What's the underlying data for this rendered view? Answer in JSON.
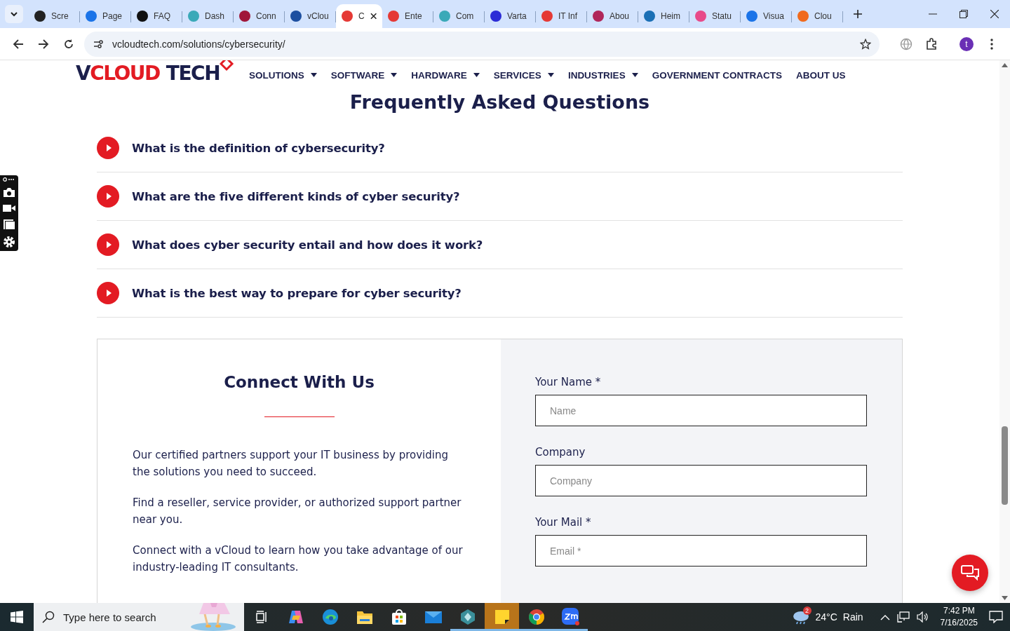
{
  "browser": {
    "tabs": [
      {
        "title": "Scre",
        "color": "#222222",
        "selected": false
      },
      {
        "title": "Page",
        "color": "#1a73e8",
        "selected": false
      },
      {
        "title": "FAQ",
        "color": "#111111",
        "selected": false
      },
      {
        "title": "Dash",
        "color": "#3aa9b8",
        "selected": false
      },
      {
        "title": "Conn",
        "color": "#a0163a",
        "selected": false
      },
      {
        "title": "vClou",
        "color": "#1d4fa0",
        "selected": false
      },
      {
        "title": "C",
        "color": "#e53935",
        "selected": true
      },
      {
        "title": "Ente",
        "color": "#e53935",
        "selected": false
      },
      {
        "title": "Com",
        "color": "#3aa9b8",
        "selected": false
      },
      {
        "title": "Varta",
        "color": "#2b2bd6",
        "selected": false
      },
      {
        "title": "IT Inf",
        "color": "#e53935",
        "selected": false
      },
      {
        "title": "Abou",
        "color": "#b0265a",
        "selected": false
      },
      {
        "title": "Heim",
        "color": "#1a6fb5",
        "selected": false
      },
      {
        "title": "Statu",
        "color": "#e84a8a",
        "selected": false
      },
      {
        "title": "Visua",
        "color": "#1a73e8",
        "selected": false
      },
      {
        "title": "Clou",
        "color": "#f06a1d",
        "selected": false
      }
    ],
    "address": "vcloudtech.com/solutions/cybersecurity/",
    "profile_initial": "t"
  },
  "site_header": {
    "logo": [
      {
        "text": "V",
        "color": "#1b1f4b"
      },
      {
        "text": "CLOUD",
        "color": "#e31b23"
      },
      {
        "text": "TECH",
        "color": "#1b1f4b"
      }
    ],
    "nav": [
      {
        "label": "SOLUTIONS",
        "dropdown": true
      },
      {
        "label": "SOFTWARE",
        "dropdown": true
      },
      {
        "label": "HARDWARE",
        "dropdown": true
      },
      {
        "label": "SERVICES",
        "dropdown": true
      },
      {
        "label": "INDUSTRIES",
        "dropdown": true
      },
      {
        "label": "GOVERNMENT CONTRACTS",
        "dropdown": false
      },
      {
        "label": "ABOUT US",
        "dropdown": false
      }
    ]
  },
  "faq": {
    "title": "Frequently Asked Questions",
    "questions": [
      {
        "text": "What is the definition of cybersecurity?",
        "expanded": false
      },
      {
        "text": "What are the five different kinds of cyber security?",
        "expanded": false
      },
      {
        "text": "What does cyber security entail and how does it work?",
        "expanded": false
      },
      {
        "text": "What is the best way to prepare for cyber security?",
        "expanded": false
      }
    ]
  },
  "connect": {
    "title": "Connect With Us",
    "paragraphs": [
      "Our certified partners support your IT business by providing the solutions you need to succeed.",
      "Find a reseller, service provider, or authorized support partner near you.",
      "Connect with a vCloud to learn how you take advantage of our industry-leading IT consultants."
    ],
    "fields": [
      {
        "label": "Your Name *",
        "placeholder": "Name"
      },
      {
        "label": "Company",
        "placeholder": "Company"
      },
      {
        "label": "Your Mail *",
        "placeholder": "Email *"
      }
    ]
  },
  "taskbar": {
    "search_placeholder": "Type here to search",
    "apps": [
      {
        "kind": "task-view",
        "running": false
      },
      {
        "kind": "copilot",
        "running": false
      },
      {
        "kind": "edge",
        "running": false
      },
      {
        "kind": "files",
        "running": false
      },
      {
        "kind": "store",
        "running": false
      },
      {
        "kind": "mail",
        "running": false
      },
      {
        "kind": "hexagon",
        "running": true
      },
      {
        "kind": "notes",
        "running": true
      },
      {
        "kind": "chrome",
        "running": true
      },
      {
        "kind": "zoom",
        "running": true
      }
    ],
    "weather": {
      "badge": "2",
      "temperature": "24°C",
      "condition": "Rain"
    },
    "time": "7:42 PM",
    "date": "7/16/2025"
  }
}
